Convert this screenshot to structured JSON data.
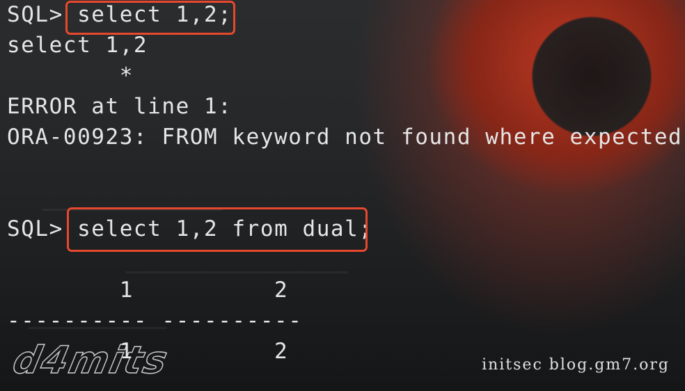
{
  "terminal": {
    "line1": {
      "prompt": "SQL> ",
      "command": "select 1,2;"
    },
    "line2": "select 1,2",
    "line3": "        *",
    "line4": "ERROR at line 1:",
    "line5": "ORA-00923: FROM keyword not found where expected",
    "line6": {
      "prompt": "SQL> ",
      "command": "select 1,2 from dual;"
    },
    "header_row": "        1          2",
    "separator_row": "---------- ----------",
    "result_row": "        1          2"
  },
  "watermarks": {
    "left": "d4mits",
    "right": "initsec blog.gm7.org"
  },
  "colors": {
    "highlight": "#e8492e",
    "text": "#e6e6e6"
  }
}
